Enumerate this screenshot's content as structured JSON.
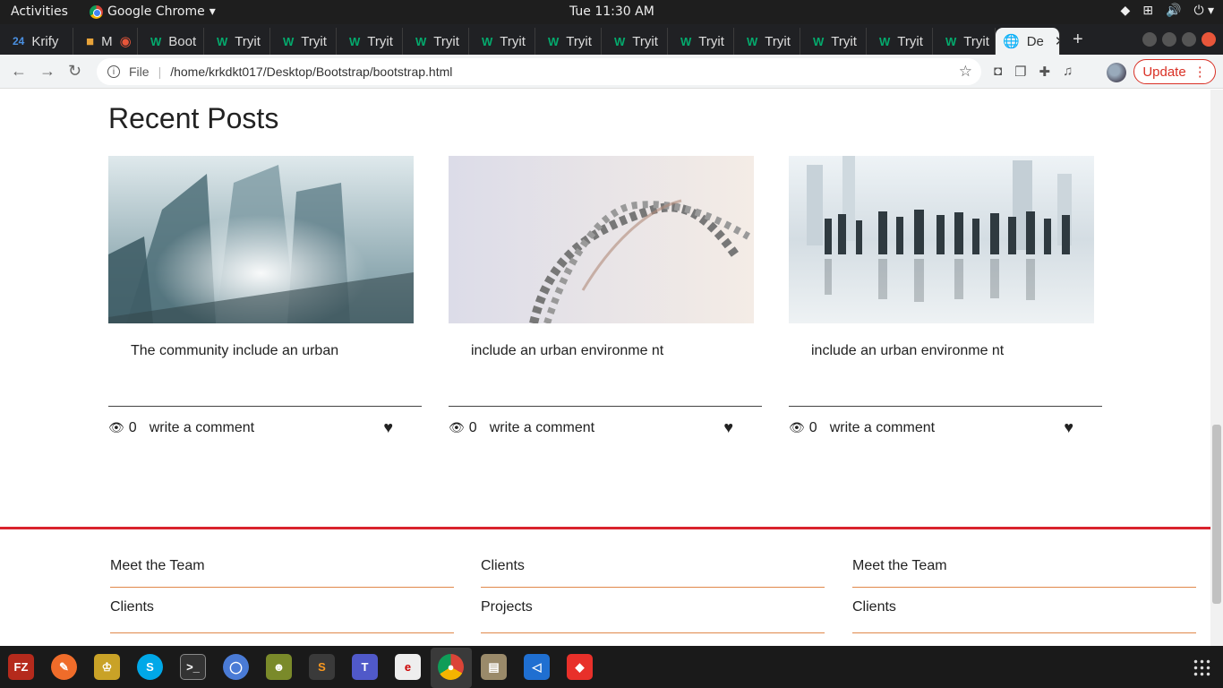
{
  "system_bar": {
    "activities": "Activities",
    "app_name": "Google Chrome",
    "clock": "Tue 11:30 AM"
  },
  "tabs": [
    {
      "label": "Krify",
      "icon": "calendar-24-icon"
    },
    {
      "label": "M",
      "icon": "meet-icon"
    },
    {
      "label": "Boot",
      "icon": "w3schools-icon"
    },
    {
      "label": "Tryit",
      "icon": "w3schools-icon"
    },
    {
      "label": "Tryit",
      "icon": "w3schools-icon"
    },
    {
      "label": "Tryit",
      "icon": "w3schools-icon"
    },
    {
      "label": "Tryit",
      "icon": "w3schools-icon"
    },
    {
      "label": "Tryit",
      "icon": "w3schools-icon"
    },
    {
      "label": "Tryit",
      "icon": "w3schools-icon"
    },
    {
      "label": "Tryit",
      "icon": "w3schools-icon"
    },
    {
      "label": "Tryit",
      "icon": "w3schools-icon"
    },
    {
      "label": "Tryit",
      "icon": "w3schools-icon"
    },
    {
      "label": "Tryit",
      "icon": "w3schools-icon"
    },
    {
      "label": "Tryit",
      "icon": "w3schools-icon"
    },
    {
      "label": "Tryit",
      "icon": "w3schools-icon"
    },
    {
      "label": "De",
      "icon": "globe-icon",
      "active": true
    }
  ],
  "address_bar": {
    "scheme_label": "File",
    "url": "/home/krkdkt017/Desktop/Bootstrap/bootstrap.html"
  },
  "update_button": "Update",
  "page": {
    "section_title": "Recent Posts",
    "posts": [
      {
        "text": "The community include an urban",
        "views": "0",
        "comment": "write a comment"
      },
      {
        "text": "include an urban environme nt",
        "views": "0",
        "comment": "write a comment"
      },
      {
        "text": "include an urban environme nt",
        "views": "0",
        "comment": "write a comment"
      }
    ],
    "footer_columns": [
      [
        "Meet the Team",
        "Clients"
      ],
      [
        "Clients",
        "Projects"
      ],
      [
        "Meet the Team",
        "Clients"
      ]
    ]
  },
  "colors": {
    "accent_red": "#d9232d",
    "footer_rule": "#e0884a",
    "update_red": "#d93025"
  },
  "dock": [
    "filezilla",
    "postman",
    "gaming-app",
    "skype",
    "terminal",
    "chromium",
    "monkey-app",
    "sublime-text",
    "teams",
    "pdf-app",
    "chrome",
    "archive",
    "vscode",
    "anydesk"
  ]
}
